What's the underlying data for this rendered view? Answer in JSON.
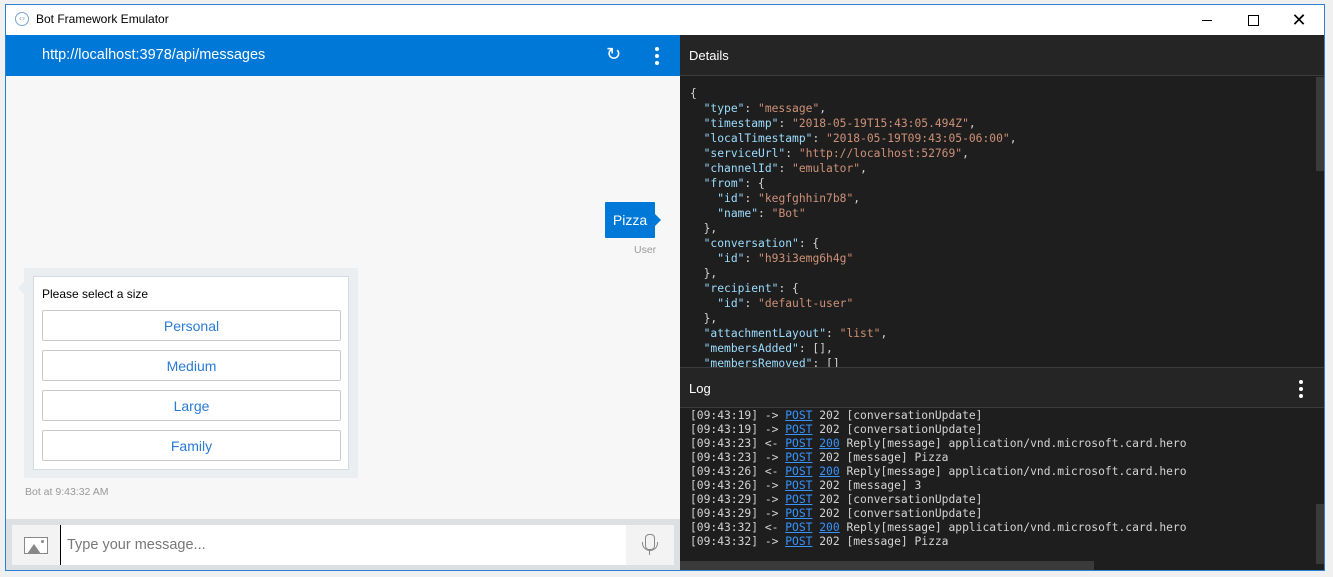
{
  "window": {
    "title": "Bot Framework Emulator",
    "controls": {
      "minimize": "minimize",
      "maximize": "maximize",
      "close": "✕"
    }
  },
  "chat": {
    "endpoint_url": "http://localhost:3978/api/messages",
    "icons": {
      "refresh": "↻",
      "menu": "more-vertical"
    },
    "messages": [
      {
        "from": "user",
        "text": "Pizza",
        "label": "User"
      },
      {
        "from": "bot",
        "card": {
          "text": "Please select a size",
          "buttons": [
            "Personal",
            "Medium",
            "Large",
            "Family"
          ]
        },
        "label": "Bot at 9:43:32 AM"
      }
    ],
    "input": {
      "placeholder": "Type your message...",
      "value": ""
    }
  },
  "details": {
    "title": "Details",
    "json_lines": [
      [
        [
          "p",
          "{"
        ]
      ],
      [
        [
          "p",
          "  "
        ],
        [
          "k",
          "\"type\""
        ],
        [
          "p",
          ": "
        ],
        [
          "s",
          "\"message\""
        ],
        [
          "p",
          ","
        ]
      ],
      [
        [
          "p",
          "  "
        ],
        [
          "k",
          "\"timestamp\""
        ],
        [
          "p",
          ": "
        ],
        [
          "s",
          "\"2018-05-19T15:43:05.494Z\""
        ],
        [
          "p",
          ","
        ]
      ],
      [
        [
          "p",
          "  "
        ],
        [
          "k",
          "\"localTimestamp\""
        ],
        [
          "p",
          ": "
        ],
        [
          "s",
          "\"2018-05-19T09:43:05-06:00\""
        ],
        [
          "p",
          ","
        ]
      ],
      [
        [
          "p",
          "  "
        ],
        [
          "k",
          "\"serviceUrl\""
        ],
        [
          "p",
          ": "
        ],
        [
          "s",
          "\"http://localhost:52769\""
        ],
        [
          "p",
          ","
        ]
      ],
      [
        [
          "p",
          "  "
        ],
        [
          "k",
          "\"channelId\""
        ],
        [
          "p",
          ": "
        ],
        [
          "s",
          "\"emulator\""
        ],
        [
          "p",
          ","
        ]
      ],
      [
        [
          "p",
          "  "
        ],
        [
          "k",
          "\"from\""
        ],
        [
          "p",
          ": {"
        ]
      ],
      [
        [
          "p",
          "    "
        ],
        [
          "k",
          "\"id\""
        ],
        [
          "p",
          ": "
        ],
        [
          "s",
          "\"kegfghhin7b8\""
        ],
        [
          "p",
          ","
        ]
      ],
      [
        [
          "p",
          "    "
        ],
        [
          "k",
          "\"name\""
        ],
        [
          "p",
          ": "
        ],
        [
          "s",
          "\"Bot\""
        ]
      ],
      [
        [
          "p",
          "  },"
        ]
      ],
      [
        [
          "p",
          "  "
        ],
        [
          "k",
          "\"conversation\""
        ],
        [
          "p",
          ": {"
        ]
      ],
      [
        [
          "p",
          "    "
        ],
        [
          "k",
          "\"id\""
        ],
        [
          "p",
          ": "
        ],
        [
          "s",
          "\"h93i3emg6h4g\""
        ]
      ],
      [
        [
          "p",
          "  },"
        ]
      ],
      [
        [
          "p",
          "  "
        ],
        [
          "k",
          "\"recipient\""
        ],
        [
          "p",
          ": {"
        ]
      ],
      [
        [
          "p",
          "    "
        ],
        [
          "k",
          "\"id\""
        ],
        [
          "p",
          ": "
        ],
        [
          "s",
          "\"default-user\""
        ]
      ],
      [
        [
          "p",
          "  },"
        ]
      ],
      [
        [
          "p",
          "  "
        ],
        [
          "k",
          "\"attachmentLayout\""
        ],
        [
          "p",
          ": "
        ],
        [
          "s",
          "\"list\""
        ],
        [
          "p",
          ","
        ]
      ],
      [
        [
          "p",
          "  "
        ],
        [
          "k",
          "\"membersAdded\""
        ],
        [
          "p",
          ": [],"
        ]
      ],
      [
        [
          "p",
          "  "
        ],
        [
          "k",
          "\"membersRemoved\""
        ],
        [
          "p",
          ": []"
        ]
      ]
    ]
  },
  "log": {
    "title": "Log",
    "entries": [
      {
        "time": "[09:43:19]",
        "dir": "->",
        "method": "POST",
        "status": "202",
        "status_link": false,
        "text": "[conversationUpdate]"
      },
      {
        "time": "[09:43:19]",
        "dir": "->",
        "method": "POST",
        "status": "202",
        "status_link": false,
        "text": "[conversationUpdate]"
      },
      {
        "time": "[09:43:23]",
        "dir": "<-",
        "method": "POST",
        "status": "200",
        "status_link": true,
        "text": "Reply[message] application/vnd.microsoft.card.hero"
      },
      {
        "time": "[09:43:23]",
        "dir": "->",
        "method": "POST",
        "status": "202",
        "status_link": false,
        "text": "[message] Pizza"
      },
      {
        "time": "[09:43:26]",
        "dir": "<-",
        "method": "POST",
        "status": "200",
        "status_link": true,
        "text": "Reply[message] application/vnd.microsoft.card.hero"
      },
      {
        "time": "[09:43:26]",
        "dir": "->",
        "method": "POST",
        "status": "202",
        "status_link": false,
        "text": "[message] 3"
      },
      {
        "time": "[09:43:29]",
        "dir": "->",
        "method": "POST",
        "status": "202",
        "status_link": false,
        "text": "[conversationUpdate]"
      },
      {
        "time": "[09:43:29]",
        "dir": "->",
        "method": "POST",
        "status": "202",
        "status_link": false,
        "text": "[conversationUpdate]"
      },
      {
        "time": "[09:43:32]",
        "dir": "<-",
        "method": "POST",
        "status": "200",
        "status_link": true,
        "text": "Reply[message] application/vnd.microsoft.card.hero"
      },
      {
        "time": "[09:43:32]",
        "dir": "->",
        "method": "POST",
        "status": "202",
        "status_link": false,
        "text": "[message] Pizza"
      }
    ]
  },
  "colors": {
    "accent": "#0078d7",
    "json_key": "#9cdcfe",
    "json_string": "#ce9178",
    "log_link": "#3794ff",
    "card_button_text": "#2a7bd3"
  }
}
